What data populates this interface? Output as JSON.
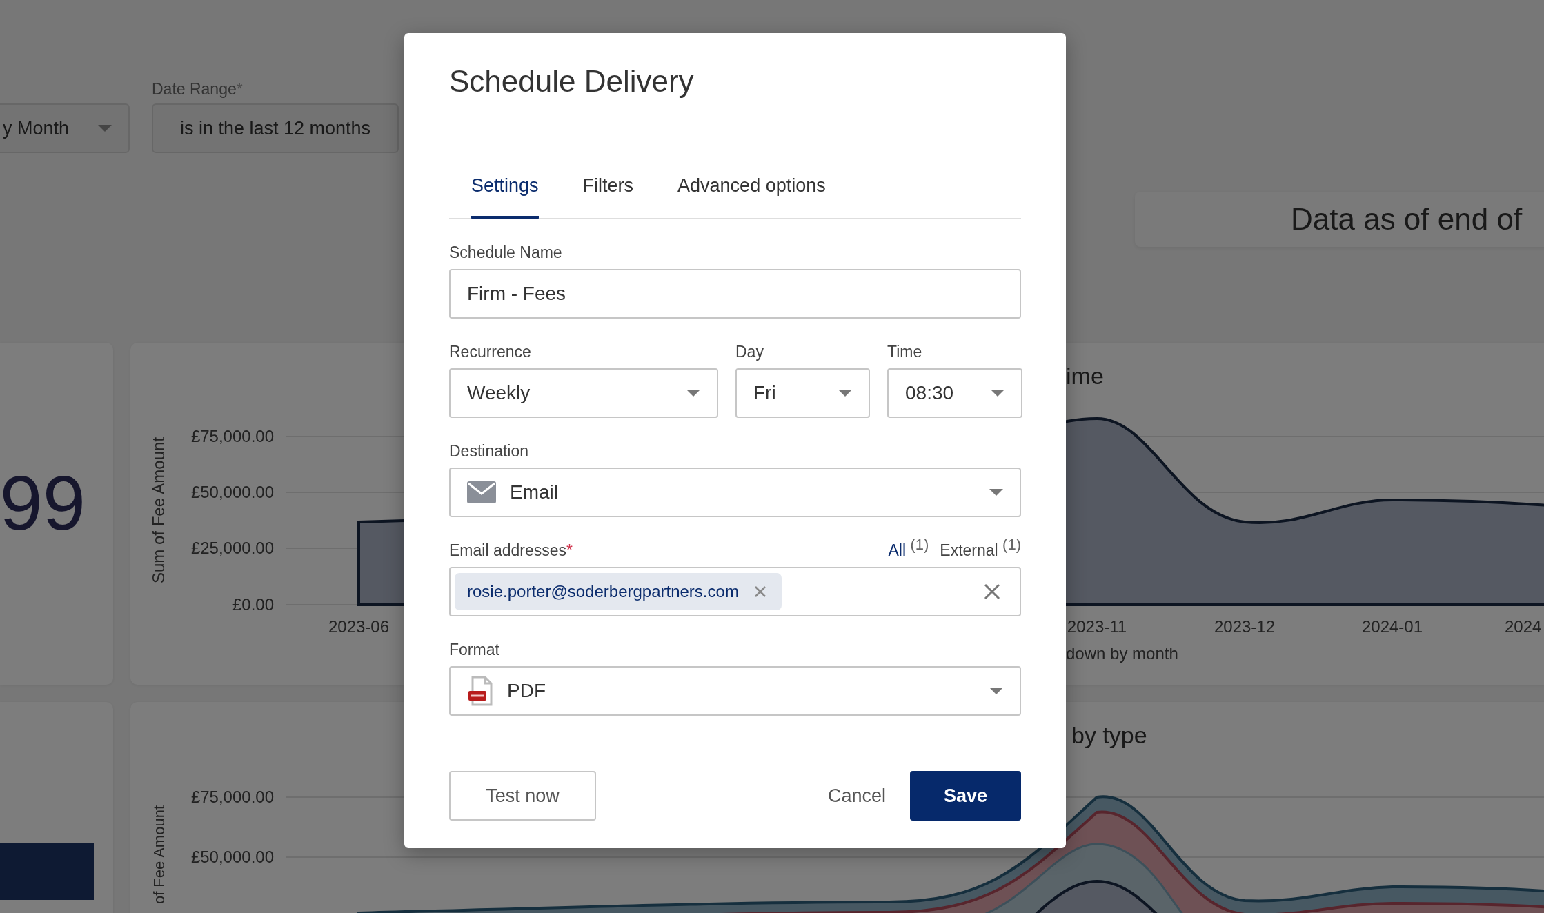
{
  "dashboard": {
    "filters": [
      {
        "kind": "select",
        "value": "y Month"
      },
      {
        "kind": "text",
        "label": "Date Range",
        "required_mark": "*",
        "value": "is in the last 12 months"
      }
    ],
    "data_note": "Data as of end of",
    "kpi_value": "99",
    "fee_chart": {
      "title": "ime",
      "y_axis_label": "Sum of Fee Amount",
      "y_ticks": [
        "£75,000.00",
        "£50,000.00",
        "£25,000.00",
        "£0.00"
      ],
      "x_labels": [
        "2023-06",
        "2023-11",
        "2023-12",
        "2024-01",
        "2024"
      ],
      "caption": "down by month"
    },
    "type_chart": {
      "title": "by type",
      "y_axis_label": "of Fee Amount",
      "y_ticks": [
        "£75,000.00",
        "£50,000.00"
      ]
    }
  },
  "dialog": {
    "title": "Schedule Delivery",
    "tabs": [
      {
        "label": "Settings",
        "selected": true
      },
      {
        "label": "Filters",
        "selected": false
      },
      {
        "label": "Advanced options",
        "selected": false
      }
    ],
    "rows": [
      [
        {
          "kind": "text",
          "label": "Schedule Name",
          "value": "Firm - Fees"
        }
      ],
      [
        {
          "kind": "select",
          "label": "Recurrence",
          "value": "Weekly"
        },
        {
          "kind": "select",
          "label": "Day",
          "value": "Fri"
        },
        {
          "kind": "select",
          "label": "Time",
          "value": "08:30"
        }
      ],
      [
        {
          "kind": "destination",
          "label": "Destination",
          "value": "Email"
        }
      ],
      [
        {
          "kind": "recipients",
          "label": "Email addresses",
          "required_mark": "*",
          "filters": [
            {
              "label": "All",
              "count": "(1)",
              "selected": true
            },
            {
              "label": "External",
              "count": "(1)",
              "selected": false
            }
          ],
          "chips": [
            "rosie.porter@soderbergpartners.com"
          ]
        }
      ],
      [
        {
          "kind": "format",
          "label": "Format",
          "value": "PDF"
        }
      ]
    ],
    "buttons": [
      {
        "label": "Test now",
        "kind": "outline"
      },
      {
        "label": "Cancel",
        "kind": "text"
      },
      {
        "label": "Save",
        "kind": "primary"
      }
    ]
  }
}
